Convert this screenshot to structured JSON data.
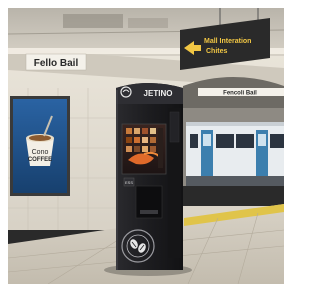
{
  "station_sign_left": "Fello Bail",
  "station_sign_right": "Fencoli Bail",
  "direction_sign": {
    "text_line1": "Mall Interation",
    "text_line2": "Chites",
    "arrow_icon": "left-arrow-icon"
  },
  "poster": {
    "line1": "Cono",
    "line2": "COFFEE",
    "icon": "coffee-cup-icon"
  },
  "kiosk": {
    "brand": "JETINO",
    "button_label": "ESS",
    "logo_icon": "coffee-bean-logo-icon"
  },
  "colors": {
    "kiosk_body": "#1c1c1f",
    "sign_bg": "#2a2a2a",
    "sign_text": "#f2c744",
    "poster_bg": "#1e4f88",
    "train_body": "#e8ecef",
    "train_door": "#3c7fae",
    "platform_edge": "#e0c44a",
    "accent_orange": "#e06a2a"
  }
}
